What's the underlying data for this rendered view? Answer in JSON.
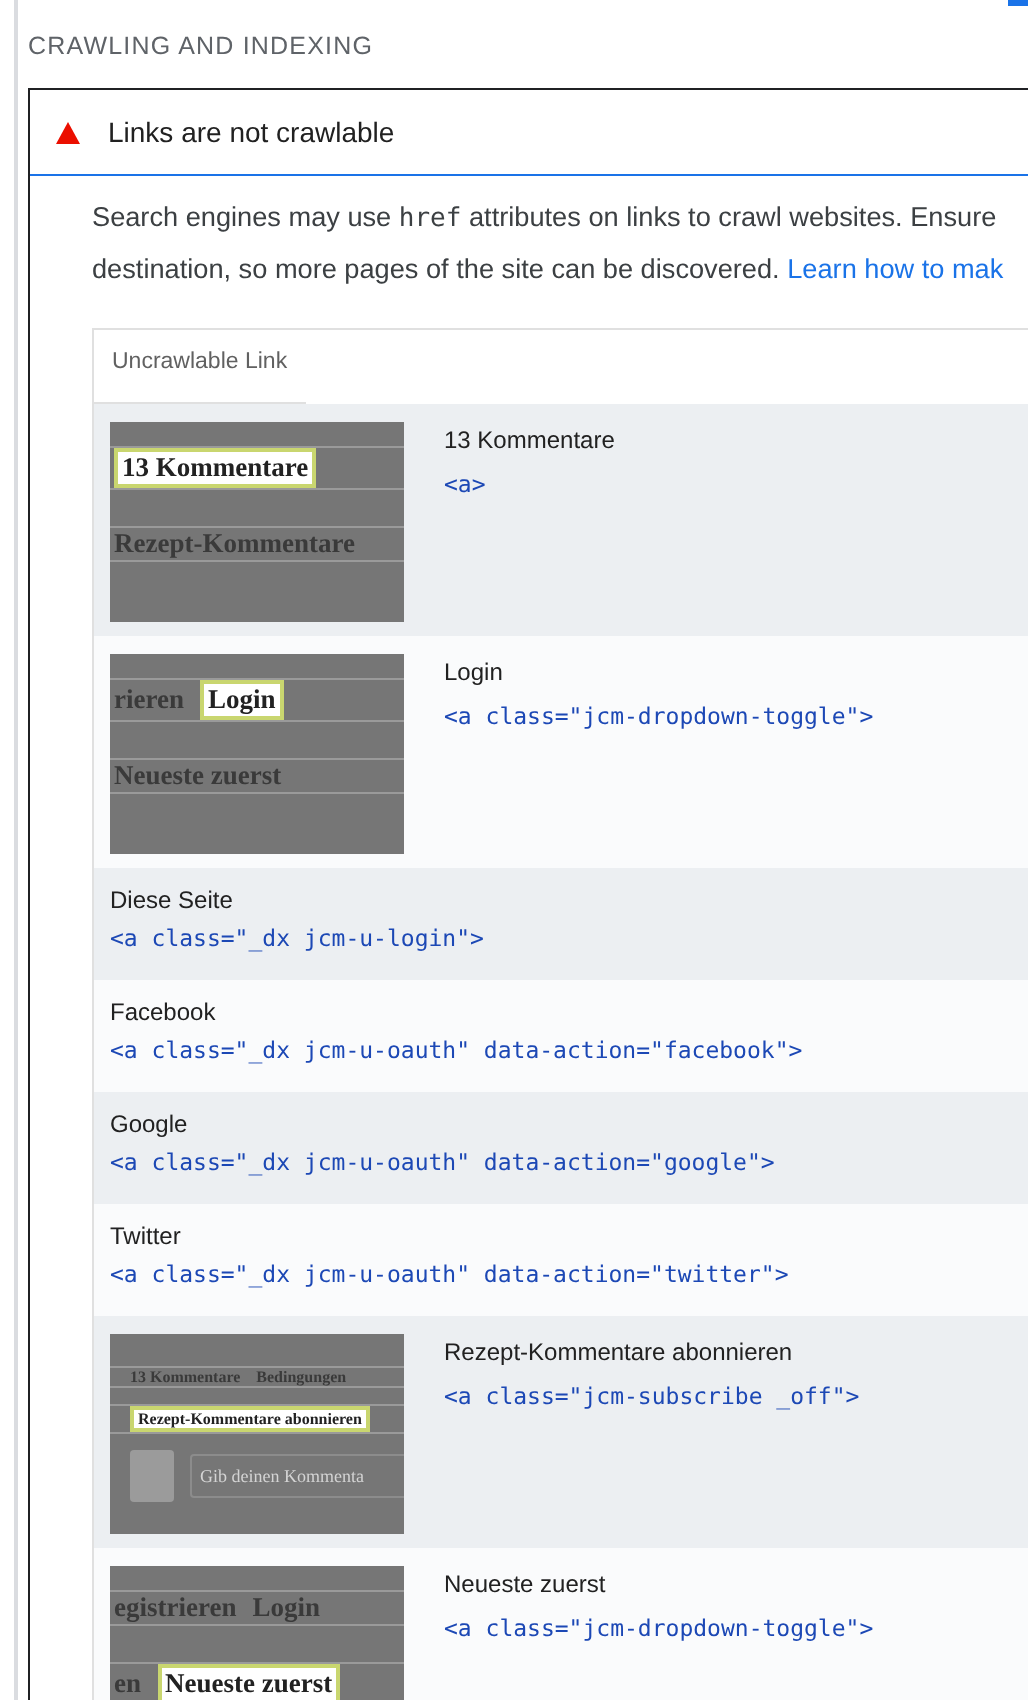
{
  "section_title": "CRAWLING AND INDEXING",
  "audit": {
    "failed": true,
    "title": "Links are not crawlable",
    "description": {
      "text_1": "Search engines may use",
      "code": "href",
      "text_2": "attributes on links to crawl websites. Ensure",
      "text_3": "destination, so more pages of the site can be discovered.",
      "link": "Learn how to mak"
    },
    "table": {
      "columns": [
        "Uncrawlable Link"
      ],
      "rows": [
        {
          "kind": "thumbnail",
          "label": "13 Kommentare",
          "snippet": "<a>",
          "thumbnail": {
            "kind": "close_up",
            "lines": [
              [
                {
                  "kind": "highlight",
                  "text": "13 Kommentare"
                }
              ],
              [
                {
                  "kind": "word",
                  "text": "Rezept-Kommentare"
                }
              ]
            ]
          }
        },
        {
          "kind": "thumbnail",
          "label": "Login",
          "snippet": "<a class=\"jcm-dropdown-toggle\">",
          "thumbnail": {
            "kind": "close_up",
            "lines": [
              [
                {
                  "kind": "word",
                  "text": "rieren"
                },
                {
                  "kind": "highlight",
                  "text": "Login"
                }
              ],
              [
                {
                  "kind": "word",
                  "text": "Neueste zuerst"
                }
              ]
            ]
          }
        },
        {
          "kind": "text",
          "label": "Diese Seite",
          "snippet": "<a class=\"_dx jcm-u-login\">"
        },
        {
          "kind": "text",
          "label": "Facebook",
          "snippet": "<a class=\"_dx jcm-u-oauth\" data-action=\"facebook\">"
        },
        {
          "kind": "text",
          "label": "Google",
          "snippet": "<a class=\"_dx jcm-u-oauth\" data-action=\"google\">"
        },
        {
          "kind": "text",
          "label": "Twitter",
          "snippet": "<a class=\"_dx jcm-u-oauth\" data-action=\"twitter\">"
        },
        {
          "kind": "thumbnail",
          "label": "Rezept-Kommentare abonnieren",
          "snippet": "<a class=\"jcm-subscribe _off\">",
          "thumbnail": {
            "kind": "wide",
            "lines": [
              [
                {
                  "kind": "word",
                  "text": "13 Kommentare"
                },
                {
                  "kind": "word",
                  "text": "Bedingungen"
                }
              ],
              [
                {
                  "kind": "highlight",
                  "text": "Rezept-Kommentare abonnieren"
                }
              ],
              [
                {
                  "kind": "avatar"
                },
                {
                  "kind": "input",
                  "text": "Gib deinen Kommenta"
                }
              ]
            ]
          }
        },
        {
          "kind": "thumbnail",
          "label": "Neueste zuerst",
          "snippet": "<a class=\"jcm-dropdown-toggle\">",
          "thumbnail": {
            "kind": "close_up",
            "lines": [
              [
                {
                  "kind": "word",
                  "text": "egistrieren"
                },
                {
                  "kind": "word",
                  "text": "Login"
                }
              ],
              [
                {
                  "kind": "word",
                  "text": "en"
                },
                {
                  "kind": "highlight",
                  "text": "Neueste zuerst"
                }
              ]
            ]
          }
        }
      ]
    }
  }
}
